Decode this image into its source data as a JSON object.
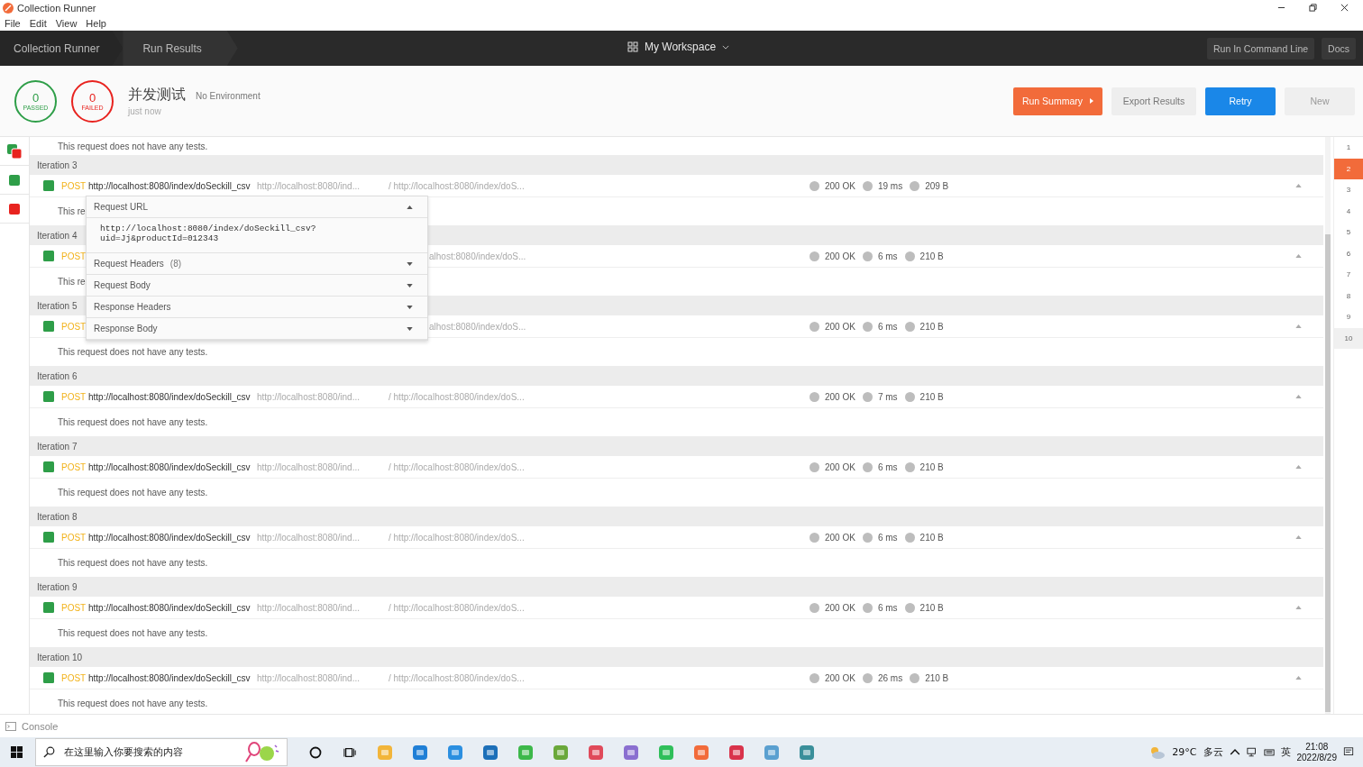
{
  "window": {
    "title": "Collection Runner"
  },
  "menu": [
    "File",
    "Edit",
    "View",
    "Help"
  ],
  "breadcrumbs": [
    "Collection Runner",
    "Run Results"
  ],
  "workspace": "My Workspace",
  "nav_buttons": [
    "Run In Command Line",
    "Docs"
  ],
  "summary": {
    "passed": {
      "count": "0",
      "label": "PASSED"
    },
    "failed": {
      "count": "0",
      "label": "FAILED"
    },
    "name": "并发测试",
    "environment": "No Environment",
    "time": "just now"
  },
  "actions": [
    {
      "label": "Run Summary",
      "kind": "summary"
    },
    {
      "label": "Export Results",
      "kind": "plain"
    },
    {
      "label": "Retry",
      "kind": "primary"
    },
    {
      "label": "New",
      "kind": "muted"
    }
  ],
  "top_note": "This request does not have any tests.",
  "iterations": [
    {
      "label": "Iteration 3",
      "method": "POST",
      "url": "http://localhost:8080/index/doSeckill_csv",
      "request_url": "http://localhost:8080/ind...",
      "response_url": "/ http://localhost:8080/index/doS...",
      "status": "200 OK",
      "time": "19 ms",
      "size": "209 B",
      "tests": "This re"
    },
    {
      "label": "Iteration 4",
      "method": "POST",
      "response_url": "alhost:8080/index/doS...",
      "status": "200 OK",
      "time": "6 ms",
      "size": "210 B",
      "tests": "This re"
    },
    {
      "label": "Iteration 5",
      "method": "POST",
      "response_url": "alhost:8080/index/doS...",
      "status": "200 OK",
      "time": "6 ms",
      "size": "210 B",
      "tests": "This request does not have any tests."
    },
    {
      "label": "Iteration 6",
      "method": "POST",
      "url": "http://localhost:8080/index/doSeckill_csv",
      "request_url": "http://localhost:8080/ind...",
      "response_url": "/ http://localhost:8080/index/doS...",
      "status": "200 OK",
      "time": "7 ms",
      "size": "210 B",
      "tests": "This request does not have any tests."
    },
    {
      "label": "Iteration 7",
      "method": "POST",
      "url": "http://localhost:8080/index/doSeckill_csv",
      "request_url": "http://localhost:8080/ind...",
      "response_url": "/ http://localhost:8080/index/doS...",
      "status": "200 OK",
      "time": "6 ms",
      "size": "210 B",
      "tests": "This request does not have any tests."
    },
    {
      "label": "Iteration 8",
      "method": "POST",
      "url": "http://localhost:8080/index/doSeckill_csv",
      "request_url": "http://localhost:8080/ind...",
      "response_url": "/ http://localhost:8080/index/doS...",
      "status": "200 OK",
      "time": "6 ms",
      "size": "210 B",
      "tests": "This request does not have any tests."
    },
    {
      "label": "Iteration 9",
      "method": "POST",
      "url": "http://localhost:8080/index/doSeckill_csv",
      "request_url": "http://localhost:8080/ind...",
      "response_url": "/ http://localhost:8080/index/doS...",
      "status": "200 OK",
      "time": "6 ms",
      "size": "210 B",
      "tests": "This request does not have any tests."
    },
    {
      "label": "Iteration 10",
      "method": "POST",
      "url": "http://localhost:8080/index/doSeckill_csv",
      "request_url": "http://localhost:8080/ind...",
      "response_url": "/ http://localhost:8080/index/doS...",
      "status": "200 OK",
      "time": "26 ms",
      "size": "210 B",
      "tests": "This request does not have any tests."
    }
  ],
  "popover": {
    "sections": [
      {
        "label": "Request URL",
        "expanded": true,
        "body": "http://localhost:8080/index/doSeckill_csv?\nuid=Jj&productId=012343"
      },
      {
        "label": "Request Headers",
        "count": "(8)",
        "expanded": false
      },
      {
        "label": "Request Body",
        "expanded": false
      },
      {
        "label": "Response Headers",
        "expanded": false
      },
      {
        "label": "Response Body",
        "expanded": false
      }
    ]
  },
  "iteration_index": [
    {
      "label": "1",
      "selected": false
    },
    {
      "label": "2",
      "selected": true
    },
    {
      "label": "3",
      "selected": false
    },
    {
      "label": "4",
      "selected": false
    },
    {
      "label": "5",
      "selected": false
    },
    {
      "label": "6",
      "selected": false
    },
    {
      "label": "7",
      "selected": false
    },
    {
      "label": "8",
      "selected": false
    },
    {
      "label": "9",
      "selected": false
    },
    {
      "label": "10",
      "selected": false
    }
  ],
  "console": "Console",
  "taskbar": {
    "search_placeholder": "在这里输入你要搜索的内容",
    "temperature": "29°C",
    "weather": "多云",
    "ime": "英",
    "time": "21:08",
    "date": "2022/8/29"
  }
}
